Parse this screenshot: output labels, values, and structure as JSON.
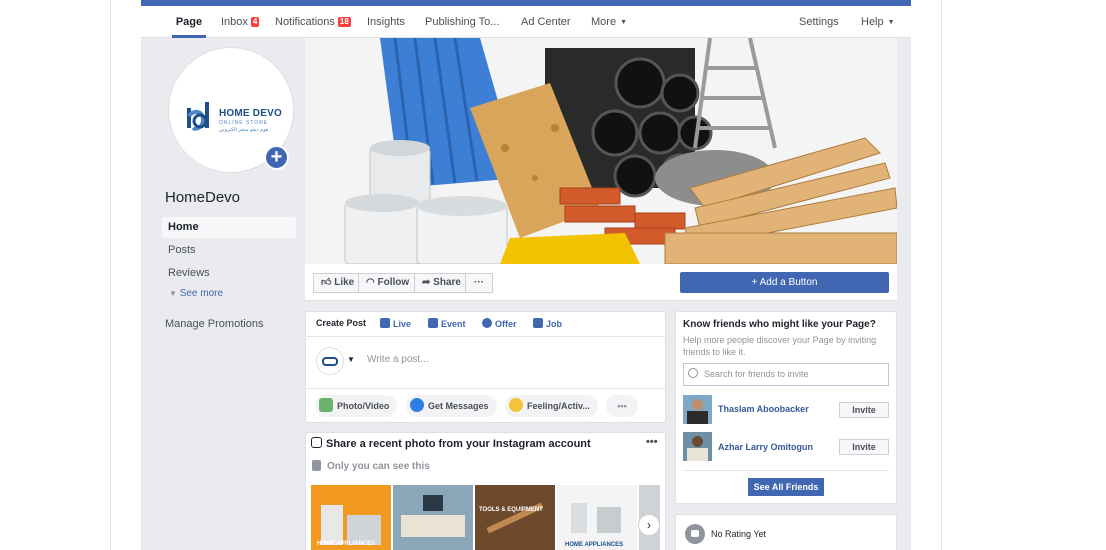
{
  "tabs": [
    {
      "label": "Page"
    },
    {
      "label": "Inbox",
      "badge": "4"
    },
    {
      "label": "Notifications",
      "badge": "18"
    },
    {
      "label": "Insights"
    },
    {
      "label": "Publishing To..."
    },
    {
      "label": "Ad Center"
    },
    {
      "label": "More"
    }
  ],
  "tabs_right": {
    "settings": "Settings",
    "help": "Help"
  },
  "page": {
    "name": "HomeDevo",
    "logo_text": "HOME DEVO",
    "logo_sub": "ONLINE STORE",
    "logo_arabic": "هوم ديفو متجر الكتروني"
  },
  "nav": {
    "items": [
      "Home",
      "Posts",
      "Reviews"
    ],
    "see_more": "See more",
    "manage_promotions": "Manage Promotions"
  },
  "actions": {
    "like": "Like",
    "follow": "Follow",
    "share": "Share",
    "more": "···",
    "add_button": "+ Add a Button"
  },
  "create_post": {
    "tabs": [
      "Create Post",
      "Live",
      "Event",
      "Offer",
      "Job"
    ],
    "placeholder": "Write a post...",
    "pills": [
      "Photo/Video",
      "Get Messages",
      "Feeling/Activ..."
    ],
    "more": "•••"
  },
  "instagram": {
    "title": "Share a recent photo from your Instagram account",
    "privacy": "Only you can see this",
    "thumbs": [
      {
        "caption": "HOME APPLIANCES"
      },
      {
        "caption": ""
      },
      {
        "caption": "TOOLS & EQUIPMENT"
      },
      {
        "caption": "HOME APPLIANCES"
      }
    ]
  },
  "invite": {
    "title": "Know friends who might like your Page?",
    "subtitle": "Help more people discover your Page by inviting friends to like it.",
    "search_placeholder": "Search for friends to invite",
    "friends": [
      {
        "name": "Thaslam Aboobacker",
        "button": "Invite"
      },
      {
        "name": "Azhar Larry Omitogun",
        "button": "Invite"
      }
    ],
    "see_all": "See All Friends"
  },
  "rating": {
    "text": "No Rating Yet"
  },
  "colors": {
    "brand": "#4267b2",
    "background": "#e9ebee",
    "badge": "#fa3e3e"
  }
}
